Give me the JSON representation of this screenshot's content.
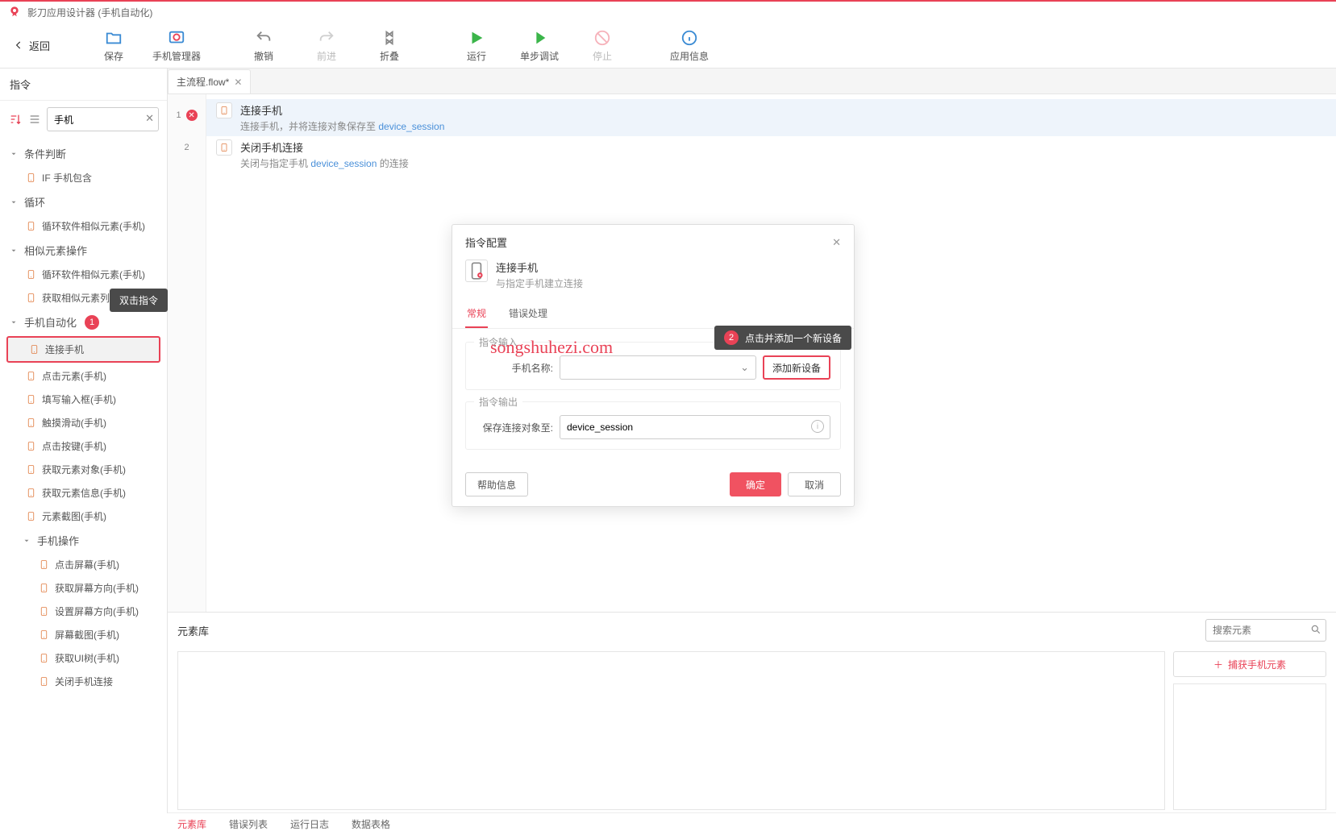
{
  "app": {
    "title": "影刀应用设计器 (手机自动化)"
  },
  "toolbar": {
    "back": "返回",
    "save": "保存",
    "phone_manager": "手机管理器",
    "undo": "撤销",
    "redo": "前进",
    "fold": "折叠",
    "run": "运行",
    "step": "单步调试",
    "stop": "停止",
    "info": "应用信息"
  },
  "sidebar": {
    "header": "指令",
    "search_value": "手机",
    "groups": [
      {
        "label": "条件判断",
        "items": [
          {
            "label": "IF 手机包含"
          }
        ]
      },
      {
        "label": "循环",
        "items": [
          {
            "label": "循环软件相似元素(手机)"
          }
        ]
      },
      {
        "label": "相似元素操作",
        "items": [
          {
            "label": "循环软件相似元素(手机)"
          },
          {
            "label": "获取相似元素列表(手机)"
          }
        ]
      },
      {
        "label": "手机自动化",
        "badge": "1",
        "items": [
          {
            "label": "连接手机",
            "highlighted": true
          },
          {
            "label": "点击元素(手机)"
          },
          {
            "label": "填写输入框(手机)"
          },
          {
            "label": "触摸滑动(手机)"
          },
          {
            "label": "点击按键(手机)"
          },
          {
            "label": "获取元素对象(手机)"
          },
          {
            "label": "获取元素信息(手机)"
          },
          {
            "label": "元素截图(手机)"
          }
        ]
      },
      {
        "label": "手机操作",
        "nested": true,
        "items": [
          {
            "label": "点击屏幕(手机)"
          },
          {
            "label": "获取屏幕方向(手机)"
          },
          {
            "label": "设置屏幕方向(手机)"
          },
          {
            "label": "屏幕截图(手机)"
          },
          {
            "label": "获取UI树(手机)"
          },
          {
            "label": "关闭手机连接"
          }
        ]
      }
    ],
    "tooltip1": "双击指令"
  },
  "flow": {
    "tab": "主流程.flow*",
    "steps": [
      {
        "n": "1",
        "error": true,
        "title": "连接手机",
        "desc_pre": "连接手机，并将连接对象保存至 ",
        "desc_var": "device_session",
        "desc_post": ""
      },
      {
        "n": "2",
        "error": false,
        "title": "关闭手机连接",
        "desc_pre": "关闭与指定手机 ",
        "desc_var": "device_session",
        "desc_post": " 的连接"
      }
    ]
  },
  "bottom": {
    "title": "元素库",
    "search_placeholder": "搜索元素",
    "capture": "捕获手机元素",
    "tabs": [
      "元素库",
      "错误列表",
      "运行日志",
      "数据表格"
    ]
  },
  "modal": {
    "title": "指令配置",
    "block_title": "连接手机",
    "block_desc": "与指定手机建立连接",
    "tabs": [
      "常规",
      "错误处理"
    ],
    "fieldset_in": "指令输入",
    "fieldset_out": "指令输出",
    "label_phone": "手机名称:",
    "add_device": "添加新设备",
    "label_save": "保存连接对象至:",
    "save_value": "device_session",
    "help": "帮助信息",
    "ok": "确定",
    "cancel": "取消",
    "tooltip2_badge": "2",
    "tooltip2_text": "点击并添加一个新设备"
  },
  "watermark": "songshuhezi.com"
}
